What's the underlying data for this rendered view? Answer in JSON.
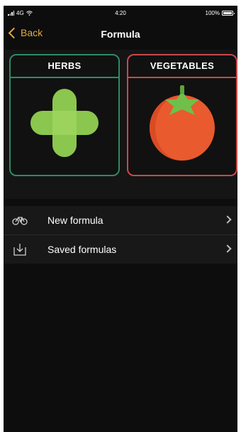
{
  "status_bar": {
    "carrier": "4G",
    "time": "4:20",
    "battery": "100%",
    "battery_level": 1.0
  },
  "nav": {
    "back_label": "Back",
    "title": "Formula"
  },
  "categories": [
    {
      "label": "HERBS",
      "icon": "cross-icon",
      "border_color": "#2e8b63"
    },
    {
      "label": "VEGETABLES",
      "icon": "tomato-icon",
      "border_color": "#c9494a"
    }
  ],
  "menu": {
    "items": [
      {
        "label": "New formula",
        "icon": "bicycle-icon"
      },
      {
        "label": "Saved formulas",
        "icon": "download-icon"
      }
    ]
  },
  "colors": {
    "accent": "#e2a93a",
    "background": "#0d0d0d",
    "herbs_green": "#8bc64e",
    "tomato_red": "#e95a2e"
  }
}
